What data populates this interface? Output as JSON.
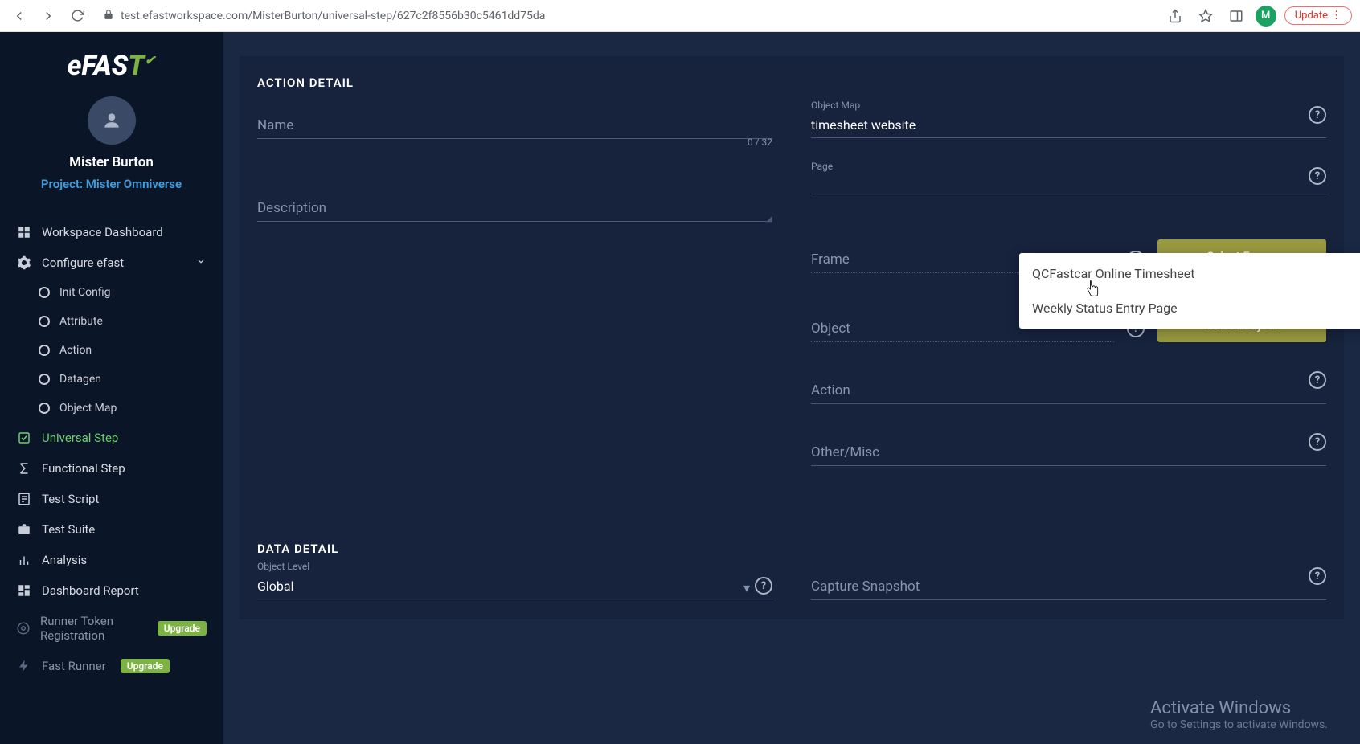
{
  "browser": {
    "url": "test.efastworkspace.com/MisterBurton/universal-step/627c2f8556b30c5461dd75da",
    "avatar_initial": "M",
    "update_label": "Update"
  },
  "logo": {
    "part1": "eFAS",
    "part2": "T"
  },
  "profile": {
    "name": "Mister Burton",
    "project": "Project: Mister Omniverse"
  },
  "sidebar": {
    "dashboard": "Workspace Dashboard",
    "configure": "Configure efast",
    "init_config": "Init Config",
    "attribute": "Attribute",
    "action": "Action",
    "datagen": "Datagen",
    "object_map": "Object Map",
    "universal_step": "Universal Step",
    "functional_step": "Functional Step",
    "test_script": "Test Script",
    "test_suite": "Test Suite",
    "analysis": "Analysis",
    "dashboard_report": "Dashboard Report",
    "runner_token": "Runner Token Registration",
    "fast_runner": "Fast Runner",
    "upgrade": "Upgrade"
  },
  "section": {
    "action_detail": "ACTION DETAIL",
    "data_detail": "DATA DETAIL"
  },
  "form": {
    "name_label": "Name",
    "name_counter": "0 / 32",
    "description_label": "Description",
    "object_map_label": "Object Map",
    "object_map_value": "timesheet website",
    "page_label": "Page",
    "frame_label": "Frame",
    "select_frame": "Select Frame",
    "object_label": "Object",
    "select_object": "Select Object",
    "action_label": "Action",
    "other_misc_label": "Other/Misc",
    "object_level_label": "Object Level",
    "object_level_value": "Global",
    "capture_snapshot_label": "Capture Snapshot"
  },
  "dropdown": {
    "option1": "QCFastcar Online Timesheet",
    "option2": "Weekly Status Entry Page"
  },
  "watermark": {
    "title": "Activate Windows",
    "subtitle": "Go to Settings to activate Windows."
  }
}
